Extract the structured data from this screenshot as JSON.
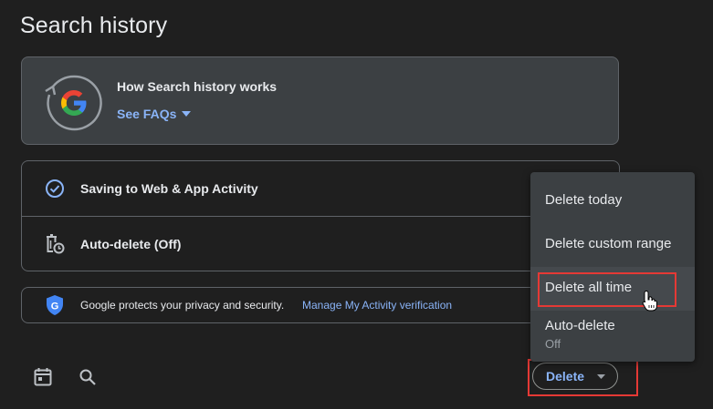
{
  "page": {
    "title": "Search history"
  },
  "info_card": {
    "title": "How Search history works",
    "faq_link": "See FAQs"
  },
  "settings": {
    "items": [
      {
        "label": "Saving to Web & App Activity",
        "icon": "check-circle-icon"
      },
      {
        "label": "Auto-delete (Off)",
        "icon": "trash-clock-icon"
      }
    ]
  },
  "privacy": {
    "text": "Google protects your privacy and security.",
    "link": "Manage My Activity verification",
    "icon": "shield-g-icon"
  },
  "toolbar": {
    "calendar_icon": "calendar-icon",
    "search_icon": "search-icon",
    "delete_label": "Delete"
  },
  "delete_menu": {
    "items": [
      {
        "label": "Delete today"
      },
      {
        "label": "Delete custom range"
      },
      {
        "label": "Delete all time"
      },
      {
        "label": "Auto-delete",
        "sub": "Off"
      }
    ]
  },
  "colors": {
    "background": "#1f1f1f",
    "card": "#3c4043",
    "accent": "#8ab4f8",
    "highlight": "#e53935"
  }
}
